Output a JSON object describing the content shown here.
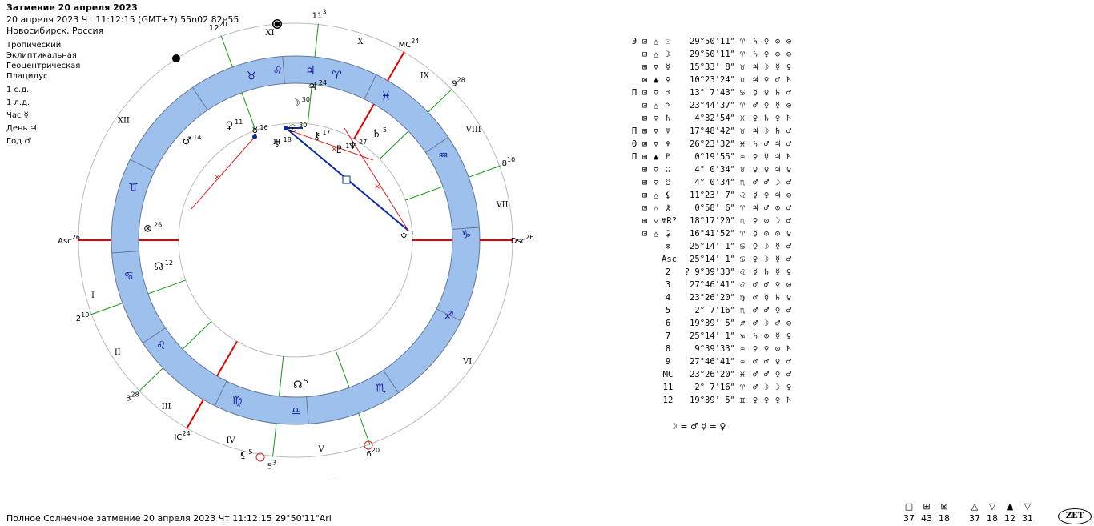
{
  "header": {
    "title": "Затмение 20 апреля 2023",
    "line1": "20 апреля 2023  Чт  11:12:15 (GMT+7) 55n02  82e55",
    "line2": "Новосибирск, Россия"
  },
  "settings": [
    "Тропический",
    "Эклиптикальная",
    "Геоцентрическая",
    "Плацидус"
  ],
  "rulers": [
    {
      "label": "1 с.д."
    },
    {
      "label": "1 л.д."
    },
    {
      "label": "Час",
      "glyph": "☿"
    },
    {
      "label": "День",
      "glyph": "♃"
    },
    {
      "label": "Год",
      "glyph": "♂"
    }
  ],
  "wheel": {
    "house_labels": [
      "I",
      "II",
      "III",
      "IV",
      "V",
      "VI",
      "VII",
      "VIII",
      "IX",
      "X",
      "XI",
      "XII"
    ],
    "cusps": [
      {
        "name": "Asc",
        "deg": "26"
      },
      {
        "name": "2",
        "deg": "10"
      },
      {
        "name": "3",
        "deg": "28"
      },
      {
        "name": "IC",
        "deg": "24"
      },
      {
        "name": "5",
        "deg": "3"
      },
      {
        "name": "6",
        "deg": "20"
      },
      {
        "name": "Dsc",
        "deg": "26"
      },
      {
        "name": "8",
        "deg": "10"
      },
      {
        "name": "9",
        "deg": "28"
      },
      {
        "name": "MC",
        "deg": "24"
      },
      {
        "name": "11",
        "deg": "3"
      },
      {
        "name": "12",
        "deg": "20"
      }
    ],
    "signs": [
      "♉",
      "♌",
      "♃",
      "♈",
      "♓",
      "♒",
      "♑",
      "♐",
      "♏",
      "♎",
      "♍",
      "♌",
      "♋",
      "♊"
    ],
    "planets": [
      {
        "glyph": "☽",
        "deg": "30"
      },
      {
        "glyph": "☉",
        "deg": "30"
      },
      {
        "glyph": "⚷",
        "deg": "17"
      },
      {
        "glyph": "♇",
        "deg": "1"
      },
      {
        "glyph": "♆",
        "deg": "27"
      },
      {
        "glyph": "♄",
        "deg": "5"
      },
      {
        "glyph": "♅",
        "deg": "18"
      },
      {
        "glyph": "☿",
        "deg": "16"
      },
      {
        "glyph": "♀",
        "deg": "11"
      },
      {
        "glyph": "♂",
        "deg": "14"
      },
      {
        "glyph": "⊗",
        "deg": "26"
      },
      {
        "glyph": "☊",
        "deg": "12"
      },
      {
        "glyph": "⚸",
        "deg": "5"
      },
      {
        "glyph": "♏R",
        "deg": "19"
      },
      {
        "glyph": "♆",
        "deg": "1"
      },
      {
        "glyph": "♃",
        "deg": "24"
      },
      {
        "glyph": "☊",
        "deg": "5"
      }
    ],
    "colors": {
      "band": "#9ec0ec",
      "zodiac": "#1a1aa0",
      "axis": "#e00000",
      "cusp": "#119911",
      "aspect_red": "#dd2222",
      "aspect_blue": "#0a2aa0"
    }
  },
  "table_rows": [
    {
      "pre": "Э",
      "box": "⊡",
      "tri": "△",
      "sym": "☉",
      "pos": "29°50'11\"",
      "sign": "♈",
      "lords": [
        "♄",
        "♀",
        "⊙",
        "⊙"
      ]
    },
    {
      "pre": "",
      "box": "⊡",
      "tri": "△",
      "sym": "☽",
      "pos": "29°50'11\"",
      "sign": "♈",
      "lords": [
        "♄",
        "♀",
        "⊙",
        "⊙"
      ]
    },
    {
      "pre": "",
      "box": "⊞",
      "tri": "▽",
      "sym": "☿",
      "pos": "15°33' 8\"",
      "sign": "♉",
      "lords": [
        "♃",
        "☽",
        "☿",
        "♀"
      ]
    },
    {
      "pre": "",
      "box": "⊠",
      "tri": "▲",
      "sym": "♀",
      "pos": "10°23'24\"",
      "sign": "♊",
      "lords": [
        "♃",
        "♀",
        "♂",
        "♄"
      ]
    },
    {
      "pre": "П",
      "box": "⊡",
      "tri": "▽",
      "sym": "♂",
      "pos": "13° 7'43\"",
      "sign": "♋",
      "lords": [
        "☿",
        "♀",
        "♄",
        "♂"
      ]
    },
    {
      "pre": "",
      "box": "⊡",
      "tri": "△",
      "sym": "♃",
      "pos": "23°44'37\"",
      "sign": "♈",
      "lords": [
        "♂",
        "♀",
        "☿",
        "⊙"
      ]
    },
    {
      "pre": "",
      "box": "⊠",
      "tri": "▽",
      "sym": "♄",
      "pos": "4°32'54\"",
      "sign": "♓",
      "lords": [
        "♀",
        "♄",
        "♀",
        "♄"
      ]
    },
    {
      "pre": "П",
      "box": "⊞",
      "tri": "▽",
      "sym": "♅",
      "pos": "17°48'42\"",
      "sign": "♉",
      "lords": [
        "♃",
        "☽",
        "♄",
        "♂"
      ]
    },
    {
      "pre": "О",
      "box": "⊠",
      "tri": "▽",
      "sym": "♆",
      "pos": "26°23'32\"",
      "sign": "♓",
      "lords": [
        "♄",
        "♂",
        "♃",
        "♂"
      ]
    },
    {
      "pre": "П",
      "box": "⊞",
      "tri": "▲",
      "sym": "♇",
      "pos": "0°19'55\"",
      "sign": "♒",
      "lords": [
        "♀",
        "☿",
        "♃",
        "♄"
      ]
    },
    {
      "pre": "",
      "box": "⊞",
      "tri": "▽",
      "sym": "☊",
      "pos": "4° 0'34\"",
      "sign": "♉",
      "lords": [
        "♀",
        "♀",
        "♃",
        "♀"
      ]
    },
    {
      "pre": "",
      "box": "⊞",
      "tri": "▽",
      "sym": "☋",
      "pos": "4° 0'34\"",
      "sign": "♏",
      "lords": [
        "♂",
        "♂",
        "☽",
        "♂"
      ]
    },
    {
      "pre": "",
      "box": "⊞",
      "tri": "△",
      "sym": "⚸",
      "pos": "11°23' 7\"",
      "sign": "♌",
      "lords": [
        "☿",
        "♀",
        "♃",
        "⊙"
      ]
    },
    {
      "pre": "",
      "box": "⊡",
      "tri": "△",
      "sym": "⚷",
      "pos": "0°58' 6\"",
      "sign": "♈",
      "lords": [
        "♃",
        "♂",
        "⊙",
        "♂"
      ]
    },
    {
      "pre": "",
      "box": "⊞",
      "tri": "▽",
      "sym": "♅R?",
      "pos": "18°17'20\"",
      "sign": "♏",
      "lords": [
        "♀",
        "⊙",
        "☽",
        "♂"
      ]
    },
    {
      "pre": "",
      "box": "⊡",
      "tri": "△",
      "sym": "⚳",
      "pos": "16°41'52\"",
      "sign": "♈",
      "lords": [
        "☿",
        "⊙",
        "⊙",
        "♀"
      ]
    },
    {
      "pre": "",
      "box": "",
      "tri": "",
      "sym": "⊗",
      "pos": "25°14' 1\"",
      "sign": "♋",
      "lords": [
        "♀",
        "☽",
        "☿",
        "♂"
      ]
    },
    {
      "pre": "",
      "box": "",
      "tri": "",
      "sym": "Asc",
      "pos": "25°14' 1\"",
      "sign": "♋",
      "lords": [
        "♀",
        "☽",
        "☿",
        "♂"
      ]
    },
    {
      "pre": "",
      "box": "",
      "tri": "",
      "sym": "2",
      "pos": "? 9°39'33\"",
      "sign": "♌",
      "lords": [
        "☿",
        "♄",
        "☿",
        "♀"
      ]
    },
    {
      "pre": "",
      "box": "",
      "tri": "",
      "sym": "3",
      "pos": "27°46'41\"",
      "sign": "♌",
      "lords": [
        "♂",
        "♂",
        "♀",
        "⊙"
      ]
    },
    {
      "pre": "",
      "box": "",
      "tri": "",
      "sym": "4",
      "pos": "23°26'20\"",
      "sign": "♍",
      "lords": [
        "♂",
        "☿",
        "♄",
        "♀"
      ]
    },
    {
      "pre": "",
      "box": "",
      "tri": "",
      "sym": "5",
      "pos": "2° 7'16\"",
      "sign": "♏",
      "lords": [
        "♂",
        "♂",
        "♀",
        "♂"
      ]
    },
    {
      "pre": "",
      "box": "",
      "tri": "",
      "sym": "6",
      "pos": "19°39' 5\"",
      "sign": "♐",
      "lords": [
        "♂",
        "☽",
        "♂",
        "⊙"
      ]
    },
    {
      "pre": "",
      "box": "",
      "tri": "",
      "sym": "7",
      "pos": "25°14' 1\"",
      "sign": "♑",
      "lords": [
        "♄",
        "⊙",
        "☿",
        "♀"
      ]
    },
    {
      "pre": "",
      "box": "",
      "tri": "",
      "sym": "8",
      "pos": "9°39'33\"",
      "sign": "♒",
      "lords": [
        "♀",
        "♀",
        "⊙",
        "♄"
      ]
    },
    {
      "pre": "",
      "box": "",
      "tri": "",
      "sym": "9",
      "pos": "27°46'41\"",
      "sign": "♒",
      "lords": [
        "♂",
        "♂",
        "♀",
        "♂"
      ]
    },
    {
      "pre": "",
      "box": "",
      "tri": "",
      "sym": "MC",
      "pos": "23°26'20\"",
      "sign": "♓",
      "lords": [
        "♂",
        "♂",
        "♀",
        "♂"
      ]
    },
    {
      "pre": "",
      "box": "",
      "tri": "",
      "sym": "11",
      "pos": "2° 7'16\"",
      "sign": "♈",
      "lords": [
        "♂",
        "☽",
        "☽",
        "♀"
      ]
    },
    {
      "pre": "",
      "box": "",
      "tri": "",
      "sym": "12",
      "pos": "19°39' 5\"",
      "sign": "♊",
      "lords": [
        "♀",
        "♀",
        "♀",
        "♄"
      ]
    }
  ],
  "aspect_line": "☽ = ♂ ☿ = ♀",
  "footer": "Полное Солнечное затмение  20 апреля 2023 Чт 11:12:15 29°50'11\"Ari",
  "stats": {
    "box_icons": [
      "□",
      "⊞",
      "⊠"
    ],
    "box_values": [
      "37",
      "43",
      "18"
    ],
    "tri_icons": [
      "△",
      "▽",
      "▲",
      "▽"
    ],
    "tri_values": [
      "37",
      "18",
      "12",
      "31"
    ]
  },
  "logo": "ZET"
}
